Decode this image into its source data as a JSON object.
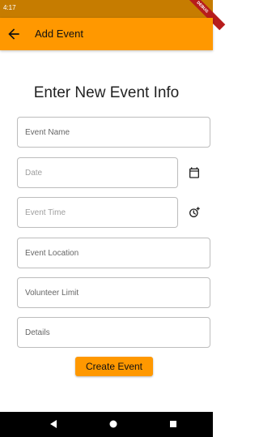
{
  "status_bar": {
    "time": "4:17",
    "debug_banner": "DEBUG"
  },
  "app_bar": {
    "title": "Add Event",
    "back_icon": "arrow-back-icon"
  },
  "form": {
    "heading": "Enter New Event Info",
    "event_name": {
      "placeholder": "Event Name",
      "value": ""
    },
    "date": {
      "placeholder": "Date",
      "value": "",
      "icon": "calendar-icon"
    },
    "event_time": {
      "placeholder": "Event Time",
      "value": "",
      "icon": "add-alarm-icon"
    },
    "event_location": {
      "placeholder": "Event Location",
      "value": ""
    },
    "volunteer_limit": {
      "placeholder": "Volunteer Limit",
      "value": ""
    },
    "details": {
      "placeholder": "Details",
      "value": ""
    },
    "submit_label": "Create Event"
  },
  "nav_bar": {
    "back": "nav-back-icon",
    "home": "nav-home-icon",
    "recents": "nav-recents-icon"
  },
  "colors": {
    "accent": "#ff9800",
    "status_bar": "#c67c00",
    "banner": "#b71c1c"
  }
}
